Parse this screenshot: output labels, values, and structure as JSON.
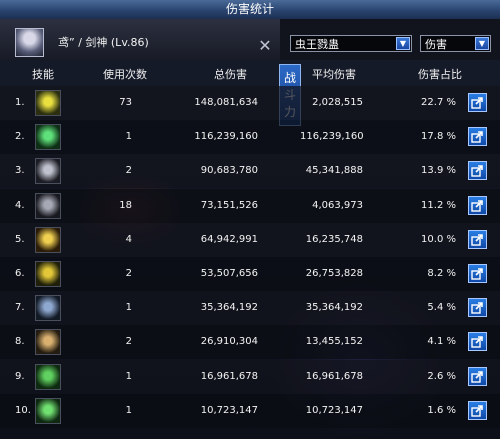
{
  "window": {
    "title": "伤害统计"
  },
  "character": {
    "name_line": "鸢” / 剑神 (Lv.86)"
  },
  "filters": {
    "target_value": "虫王戮蛊",
    "metric_value": "伤害"
  },
  "side_tab": {
    "label": "战斗力"
  },
  "columns": {
    "skill": "技能",
    "uses": "使用次数",
    "total": "总伤害",
    "avg": "平均伤害",
    "pct": "伤害占比"
  },
  "rows": [
    {
      "rank": "1.",
      "skill_icon": "skill-1-icon",
      "uses": "73",
      "total": "148,081,634",
      "avg": "2,028,515",
      "pct": "22.7 %"
    },
    {
      "rank": "2.",
      "skill_icon": "skill-2-icon",
      "uses": "1",
      "total": "116,239,160",
      "avg": "116,239,160",
      "pct": "17.8 %"
    },
    {
      "rank": "3.",
      "skill_icon": "skill-3-icon",
      "uses": "2",
      "total": "90,683,780",
      "avg": "45,341,888",
      "pct": "13.9 %"
    },
    {
      "rank": "4.",
      "skill_icon": "skill-4-icon",
      "uses": "18",
      "total": "73,151,526",
      "avg": "4,063,973",
      "pct": "11.2 %"
    },
    {
      "rank": "5.",
      "skill_icon": "skill-5-icon",
      "uses": "4",
      "total": "64,942,991",
      "avg": "16,235,748",
      "pct": "10.0 %"
    },
    {
      "rank": "6.",
      "skill_icon": "skill-6-icon",
      "uses": "2",
      "total": "53,507,656",
      "avg": "26,753,828",
      "pct": "8.2 %"
    },
    {
      "rank": "7.",
      "skill_icon": "skill-7-icon",
      "uses": "1",
      "total": "35,364,192",
      "avg": "35,364,192",
      "pct": "5.4 %"
    },
    {
      "rank": "8.",
      "skill_icon": "skill-8-icon",
      "uses": "2",
      "total": "26,910,304",
      "avg": "13,455,152",
      "pct": "4.1 %"
    },
    {
      "rank": "9.",
      "skill_icon": "skill-9-icon",
      "uses": "1",
      "total": "16,961,678",
      "avg": "16,961,678",
      "pct": "2.6 %"
    },
    {
      "rank": "10.",
      "skill_icon": "skill-10-icon",
      "uses": "1",
      "total": "10,723,147",
      "avg": "10,723,147",
      "pct": "1.6 %"
    }
  ],
  "colors": {
    "title_bar": "#2a4470",
    "accent_button": "#1a5fc8",
    "row_bg": "#15181f"
  }
}
